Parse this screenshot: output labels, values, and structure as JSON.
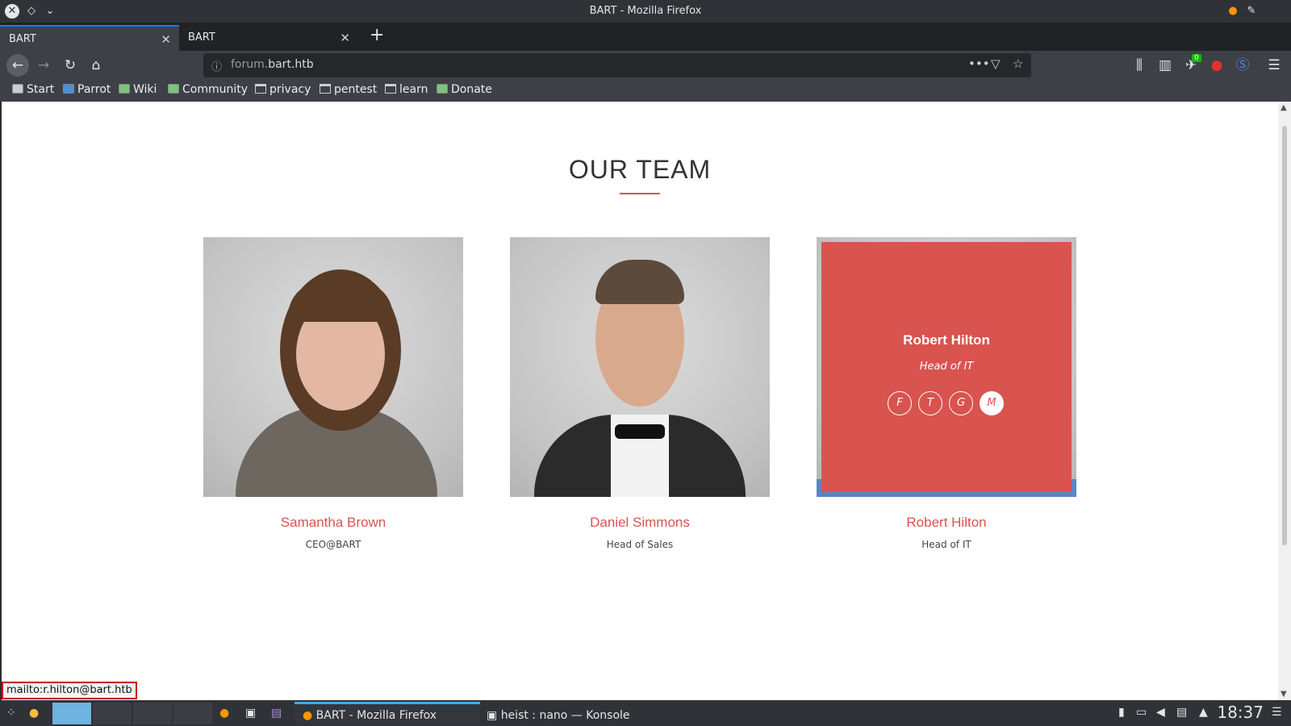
{
  "window": {
    "title": "BART - Mozilla Firefox"
  },
  "tabs": [
    {
      "label": "BART",
      "active": true
    },
    {
      "label": "BART",
      "active": false
    }
  ],
  "navbar": {
    "url_prefix": "forum.",
    "url_domain": "bart.htb",
    "badge_count": "0"
  },
  "bookmarks": [
    {
      "label": "Start",
      "icon": "page-icon"
    },
    {
      "label": "Parrot",
      "icon": "parrot-icon"
    },
    {
      "label": "Wiki",
      "icon": "wiki-icon"
    },
    {
      "label": "Community",
      "icon": "community-icon"
    },
    {
      "label": "privacy",
      "icon": "folder-icon"
    },
    {
      "label": "pentest",
      "icon": "folder-icon"
    },
    {
      "label": "learn",
      "icon": "folder-icon"
    },
    {
      "label": "Donate",
      "icon": "donate-icon"
    }
  ],
  "page": {
    "heading": "OUR TEAM",
    "accent_color": "#d9534f",
    "team": [
      {
        "name": "Samantha Brown",
        "role": "CEO@BART"
      },
      {
        "name": "Daniel Simmons",
        "role": "Head of Sales"
      },
      {
        "name": "Robert Hilton",
        "role": "Head of IT"
      }
    ],
    "hover_card": {
      "name": "Robert Hilton",
      "role": "Head of IT",
      "social": [
        "F",
        "T",
        "G",
        "M"
      ]
    }
  },
  "statusbar": {
    "text": "mailto:r.hilton@bart.htb"
  },
  "taskbar": {
    "tasks": [
      {
        "label": "BART - Mozilla Firefox",
        "active": true
      },
      {
        "label": "heist : nano — Konsole",
        "active": false
      }
    ],
    "clock": "18:37"
  }
}
